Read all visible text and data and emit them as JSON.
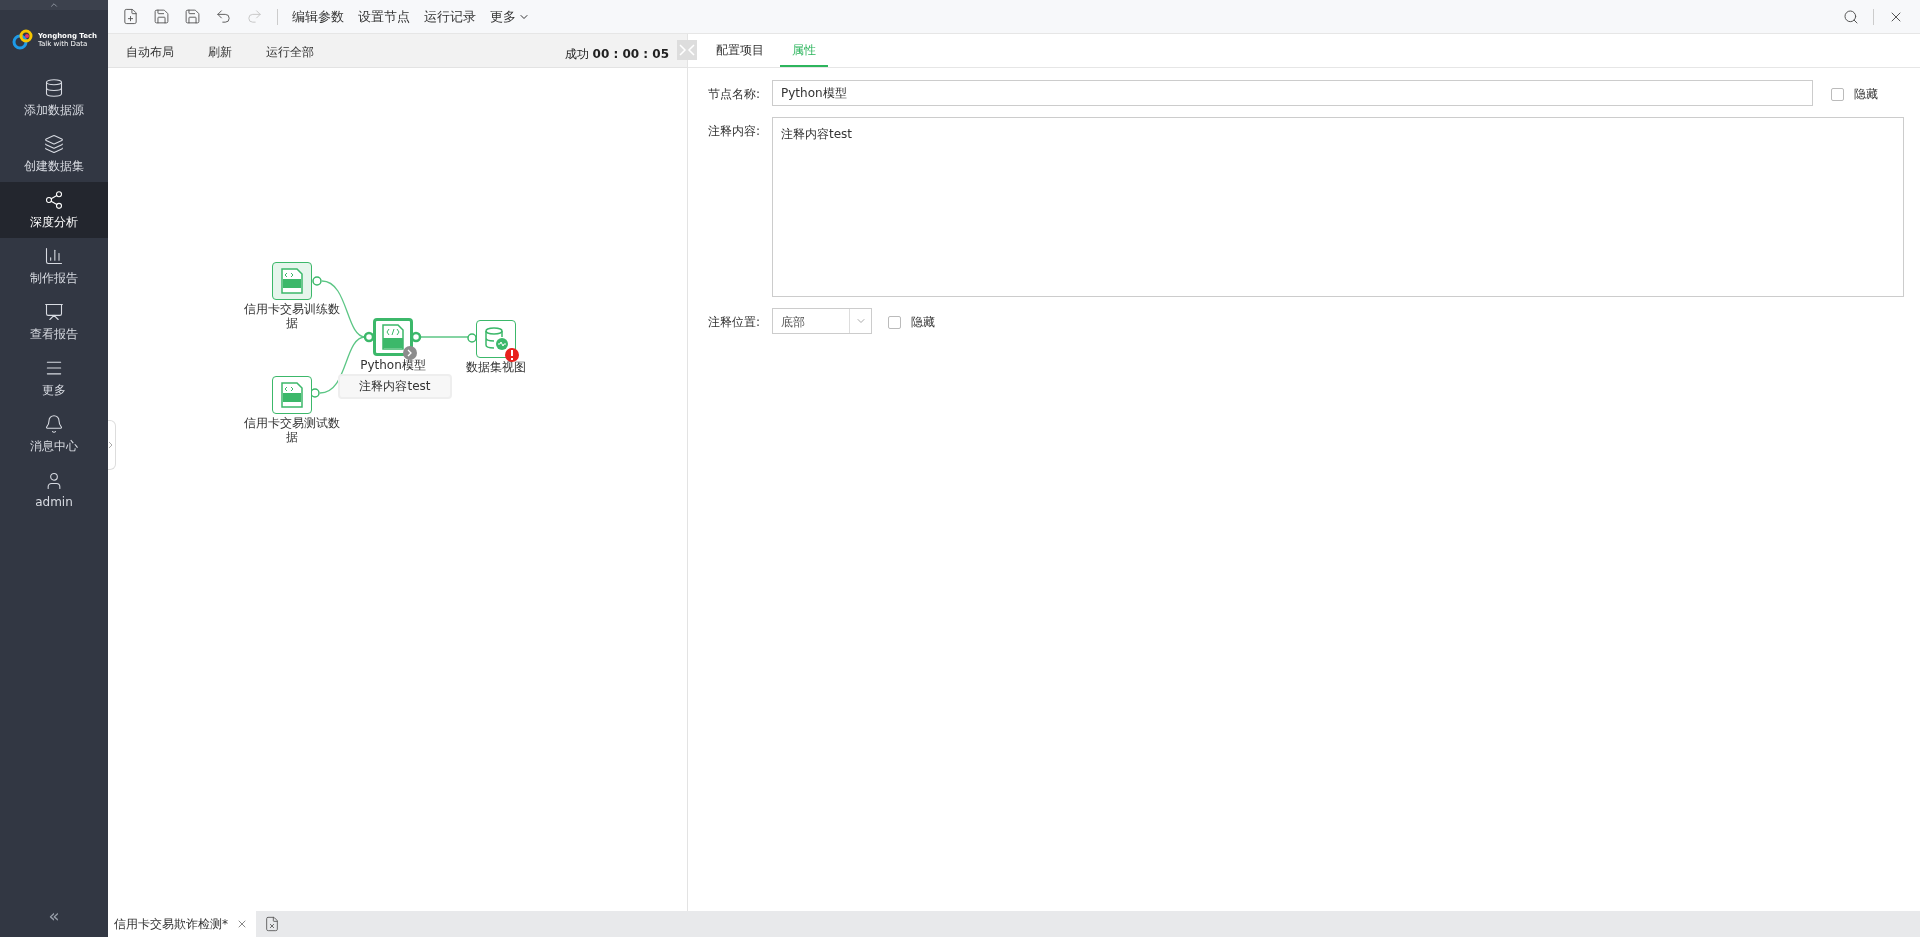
{
  "sidebar": {
    "logo_name": "Yonghong Tech",
    "logo_tagline": "Talk with Data",
    "items": [
      {
        "label": "添加数据源",
        "selected": false
      },
      {
        "label": "创建数据集",
        "selected": false
      },
      {
        "label": "深度分析",
        "selected": true
      },
      {
        "label": "制作报告",
        "selected": false
      },
      {
        "label": "查看报告",
        "selected": false
      },
      {
        "label": "更多",
        "selected": false
      },
      {
        "label": "消息中心",
        "selected": false
      },
      {
        "label": "admin",
        "selected": false
      }
    ],
    "collapse": "«"
  },
  "toolbar": {
    "icons": [
      {
        "kind": "new",
        "disabled": false
      },
      {
        "kind": "save",
        "disabled": false
      },
      {
        "kind": "save_as",
        "disabled": false
      },
      {
        "kind": "undo",
        "disabled": false
      },
      {
        "kind": "redo",
        "disabled": true
      }
    ],
    "menus": [
      "编辑参数",
      "设置节点",
      "运行记录",
      "更多"
    ]
  },
  "canvas_toolbar": {
    "actions": [
      "自动布局",
      "刷新",
      "运行全部"
    ],
    "status": "成功",
    "time": "00 : 00 : 05"
  },
  "flow": {
    "nodes": [
      {
        "kind": "sql",
        "label": "信用卡交易训练数据",
        "selected": false,
        "error": false
      },
      {
        "kind": "sql",
        "label": "信用卡交易测试数据",
        "selected": false,
        "error": false
      },
      {
        "kind": "python",
        "label": "Python模型",
        "selected": true,
        "error": false,
        "comment": "注释内容test"
      },
      {
        "kind": "dataview",
        "label": "数据集视图",
        "selected": false,
        "error": true
      }
    ]
  },
  "panel": {
    "tabs": [
      {
        "label": "配置项目",
        "selected": false
      },
      {
        "label": "属性",
        "selected": true
      }
    ],
    "name_label": "节点名称:",
    "name_value": "Python模型",
    "name_hidden": {
      "label": "隐藏",
      "checked": false
    },
    "comment_label": "注释内容:",
    "comment_value": "注释内容test",
    "position_label": "注释位置:",
    "position_value": "底部",
    "position_hidden": {
      "label": "隐藏",
      "checked": false
    }
  },
  "bottom_tabs": [
    {
      "label": "信用卡交易欺诈检测*",
      "selected": true
    }
  ]
}
